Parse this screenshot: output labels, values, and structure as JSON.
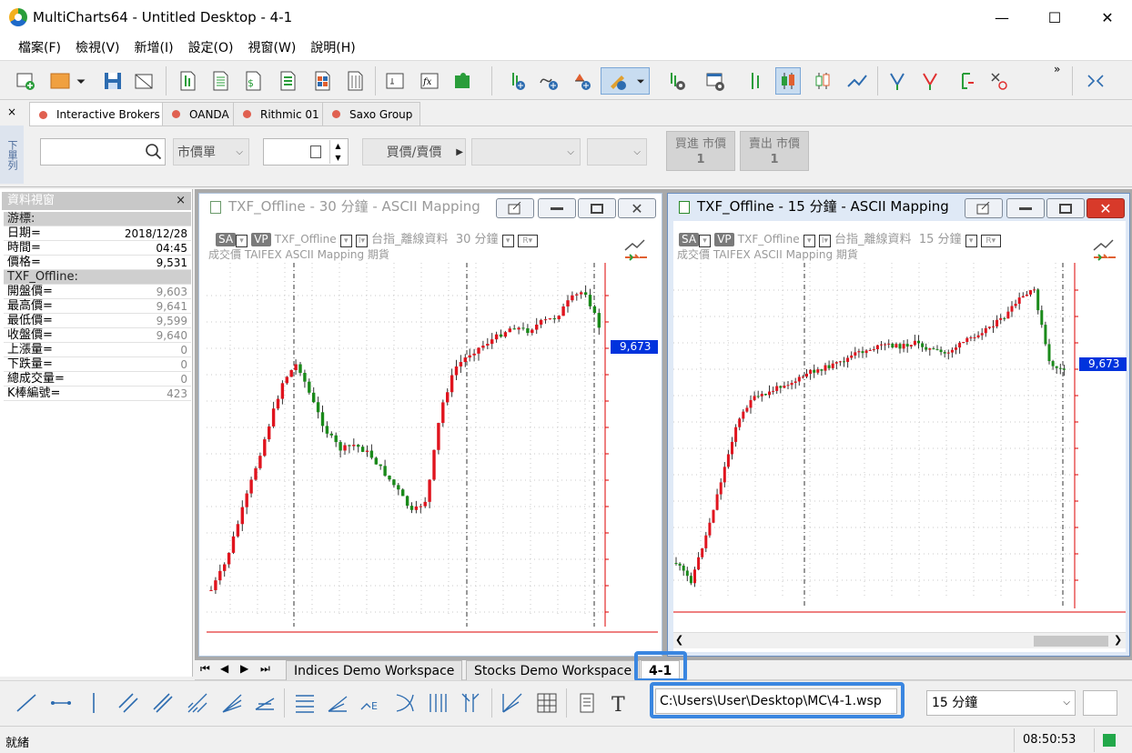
{
  "window": {
    "title": "MultiCharts64 - Untitled Desktop - 4-1",
    "minimize": "—",
    "maximize": "☐",
    "close": "✕"
  },
  "menu": [
    "檔案(F)",
    "檢視(V)",
    "新增(I)",
    "設定(O)",
    "視窗(W)",
    "說明(H)"
  ],
  "toolbar": {
    "overflow": "»"
  },
  "order_bar": {
    "close": "×",
    "side_label": "下單列",
    "brokers": [
      "Interactive Brokers",
      "OANDA",
      "Rithmic 01",
      "Saxo Group"
    ],
    "order_type": "市價單",
    "price_mode": "買價/賣價",
    "buy_label": "買進 市價",
    "buy_qty": "1",
    "sell_label": "賣出 市價",
    "sell_qty": "1"
  },
  "data_window": {
    "title": "資料視窗",
    "close": "×",
    "cursor_section": "游標:",
    "cursor_rows": [
      {
        "label": "日期=",
        "value": "2018/12/28"
      },
      {
        "label": "時間=",
        "value": "04:45"
      },
      {
        "label": "價格=",
        "value": "9,531"
      }
    ],
    "symbol_section": "TXF_Offline:",
    "symbol_rows": [
      {
        "label": "開盤價=",
        "value": "9,603"
      },
      {
        "label": "最高價=",
        "value": "9,641"
      },
      {
        "label": "最低價=",
        "value": "9,599"
      },
      {
        "label": "收盤價=",
        "value": "9,640"
      },
      {
        "label": "上漲量=",
        "value": "0"
      },
      {
        "label": "下跌量=",
        "value": "0"
      },
      {
        "label": "總成交量=",
        "value": "0"
      },
      {
        "label": "K棒編號=",
        "value": "423"
      }
    ]
  },
  "charts": [
    {
      "title": "TXF_Offline - 30 分鐘 - ASCII Mapping",
      "sa": "SA",
      "vp": "VP",
      "symbol": "TXF_Offline",
      "market": "台指_離線資料",
      "resolution": "30 分鐘",
      "sub": "成交價  TAIFEX  ASCII Mapping  期貨",
      "last_price": "9,673"
    },
    {
      "title": "TXF_Offline - 15 分鐘 - ASCII Mapping",
      "sa": "SA",
      "vp": "VP",
      "symbol": "TXF_Offline",
      "market": "台指_離線資料",
      "resolution": "15 分鐘",
      "sub": "成交價  TAIFEX  ASCII Mapping  期貨",
      "last_price": "9,673"
    }
  ],
  "workspaces": [
    "Indices Demo Workspace",
    "Stocks Demo Workspace",
    "4-1"
  ],
  "path_field": "C:\\Users\\User\\Desktop\\MC\\4-1.wsp",
  "resolution_select": "15 分鐘",
  "status": {
    "text": "就緒",
    "time": "08:50:53"
  },
  "colors": {
    "up": "#e0141e",
    "down": "#1a8a1a",
    "highlight": "#3a86e0",
    "price_tag": "#0033dd"
  }
}
